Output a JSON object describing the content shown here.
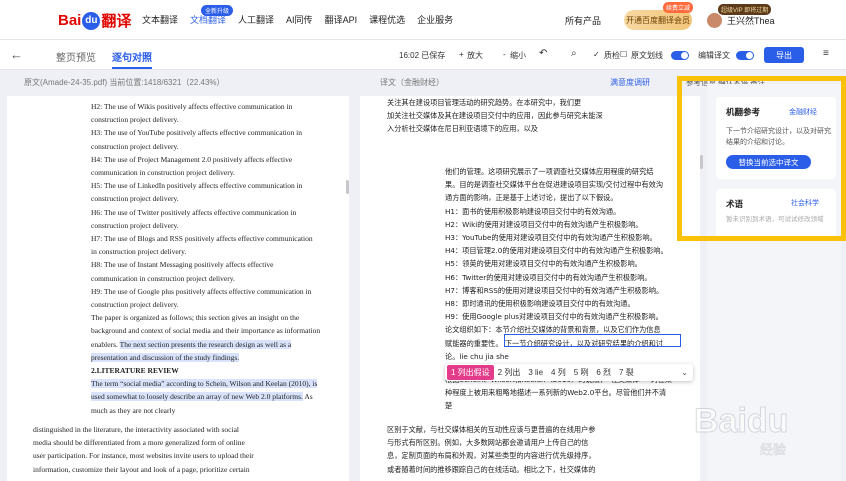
{
  "nav": {
    "logo_bai": "Bai",
    "logo_fy": "翻译",
    "items": [
      "文本翻译",
      "文档翻译",
      "人工翻译",
      "AI同传",
      "翻译API",
      "课程优选",
      "企业服务"
    ],
    "badge_upgrade": "全新升级",
    "all_products": "所有产品",
    "vip_button": "开通百度翻译会员",
    "vip_badge": "续费立减",
    "vip_badge2": "超级VIP 即将过期",
    "username": "王兴然Thea"
  },
  "toolbar": {
    "tab_preview": "整页预览",
    "tab_compare": "逐句对照",
    "saved": "16:02 已保存",
    "zoom_in": "放大",
    "zoom_out": "缩小",
    "qc": "质检",
    "original": "原文划线",
    "edit": "编辑译文",
    "export": "导出"
  },
  "subheader": {
    "source": "原文(Amade-24-35.pdf)  当前位置:1418/6321（22.43%）",
    "target": "译文（金融财经）",
    "survey": "满意度调研",
    "side_tabs": "参考信息   确认术语   备注"
  },
  "source_top": [
    "H2: The use of Wikis positively affects effective communication in",
    "construction project delivery.",
    "H3: The use of YouTube positively affects effective communication in",
    "construction project delivery.",
    "H4: The use of Project Management 2.0 positively affects effective",
    "communication in construction project delivery.",
    "H5: The use of LinkedIn positively affects effective communication in",
    "construction project delivery.",
    "H6: The use of Twitter positively affects effective communication in",
    "construction project delivery.",
    "H7: The use of Blogs and RSS positively affects effective communication",
    "in construction project delivery.",
    "H8: The use of Instant Messaging positively affects effective",
    "communication in construction project delivery.",
    "H9: The use of Google plus positively affects effective communication in",
    "construction project delivery.",
    "The paper is organized as follows; this section gives an insight on the",
    "background and context of social media and their importance as information"
  ],
  "source_hl_a": "enablers.",
  "source_hl_b": "The next section presents the research design as well as a",
  "source_hl_c": "presentation and discussion of the study findings.",
  "source_heading": "2.LITERATURE REVIEW",
  "source_lit1": "The term “social media” according to Schein, Wilson and Keelan (2010), is",
  "source_lit2": "used somewhat to loosely describe an array of new Web 2.0 platforms.",
  "source_lit2b": "As",
  "source_lit3": "much as they are not clearly",
  "source_bottom": [
    "distinguished in the literature, the interactivity associated with social",
    "media should be differentiated from a more generalized form of online",
    "user participation. For instance, most websites invite users to upload their",
    "information, customize their layout and look of a page, prioritize certain"
  ],
  "target_top": [
    "关注其在建设项目管理活动的研究趋势。在本研究中，我们更",
    "加关注社交媒体及其在建设项目交付中的应用，因此参与研究未能深",
    "入分析社交媒体在尼日利亚语境下的应用，以及"
  ],
  "target_mid": [
    "他们的管理。这项研究展示了一项调查社交媒体应用程度的研究结",
    "果。目的是调查社交媒体平台在促进建设项目实现/交付过程中有效沟",
    "通方面的影响，正是基于上述讨论，提出了以下假设。",
    "H1：面书的使用积极影响建设项目交付中的有效沟通。",
    "H2：Wiki的使用对建设项目交付中的有效沟通产生积极影响。",
    "H3：YouTube的使用对建设项目交付中的有效沟通产生积极影响。",
    "H4：项目管理2.0的使用对建设项目交付中的有效沟通产生积极影响。",
    "H5：领英的使用对建设项目交付中的有效沟通产生积极影响。",
    "H6：Twitter的使用对建设项目交付中的有效沟通产生积极影响。",
    "H7：博客和RSS的使用对建设项目交付中的有效沟通产生积极影响。",
    "H8：即时通讯的使用积极影响建设项目交付中的有效沟通。",
    "H9：使用Google plus对建设项目交付中的有效沟通产生积极影响。",
    "论文组织如下：本节介绍社交媒体的背景和背景，以及它们作为信息",
    "赋能器的重要性。"
  ],
  "target_edit": "下一节介绍研究设计，以及对研究结果的介绍和讨",
  "target_edit2": "论。lie chu jia she",
  "target_after": [
    "根据Schein、Wilson和Keelan（2010）的说法，“社交媒体”一词在某",
    "种程度上被用来粗略地描述一系列新的Web2.0平台。尽管他们并不清",
    "楚"
  ],
  "target_bottom": [
    "区别于文献，与社交媒体相关的互动性应该与更普遍的在线用户参",
    "与形式有所区别。例如，大多数网站都会邀请用户上传自己的信",
    "息，定制页面的布局和外观，对某些类型的内容进行优先级排序，",
    "或者随着时间的推移跟踪自己的在线活动。相比之下，社交媒体的"
  ],
  "ime": {
    "candidates": [
      "1 列出假设",
      "2 列出",
      "3 lie",
      "4 列",
      "5 咧",
      "6 烈",
      "7 裂"
    ]
  },
  "side": {
    "mt_title": "机翻参考",
    "mt_tag": "金融财经",
    "mt_text": "下一节介绍研究设计，以及对研究结果的介绍和讨论。",
    "mt_button": "替换当前选中译文",
    "term_title": "术语",
    "term_tag": "社会科学",
    "term_placeholder": "暂未识别到术语，可试试修改领域"
  },
  "watermark": "Baidu 经验"
}
